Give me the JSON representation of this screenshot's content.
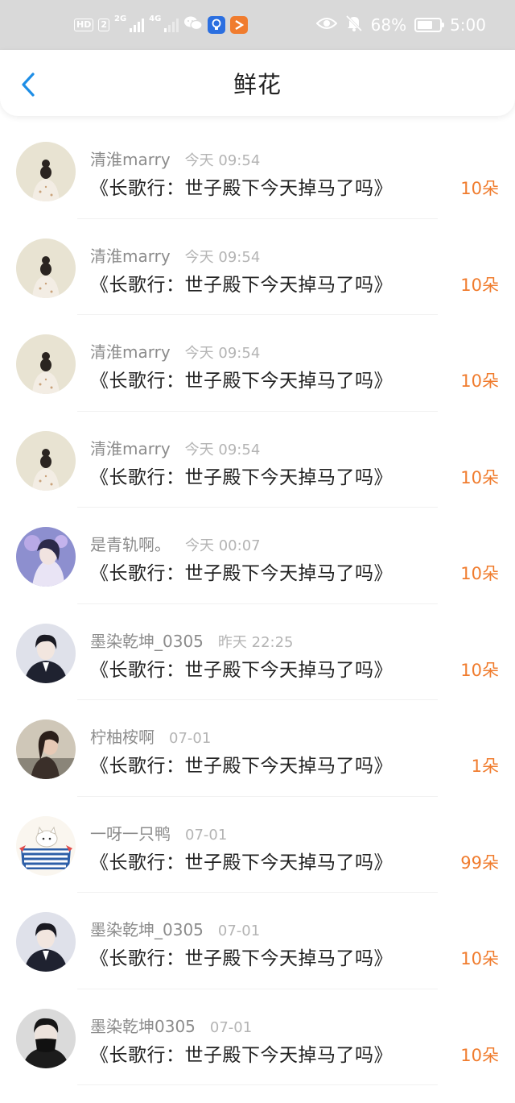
{
  "status_bar": {
    "hd_tag": "HD",
    "sim_tag": "2",
    "net1": "2G",
    "net2": "4G",
    "battery_percent": "68%",
    "battery_level": 0.68,
    "time": "5:00",
    "icons": [
      "eye-icon",
      "bell-mute-icon",
      "wechat-icon",
      "lightbulb-app-icon",
      "play-app-icon"
    ]
  },
  "nav": {
    "title": "鲜花",
    "back_icon": "chevron-left-icon",
    "accent_color": "#1e8ee6"
  },
  "colors": {
    "count": "#f07c2e",
    "username": "#8c8c8c",
    "time": "#b4b4b4"
  },
  "rows": [
    {
      "user": "清淮marry",
      "time": "今天 09:54",
      "title": "《长歌行：世子殿下今天掉马了吗》",
      "count": "10朵",
      "avatar": "avatar-girl-bun"
    },
    {
      "user": "清淮marry",
      "time": "今天 09:54",
      "title": "《长歌行：世子殿下今天掉马了吗》",
      "count": "10朵",
      "avatar": "avatar-girl-bun"
    },
    {
      "user": "清淮marry",
      "time": "今天 09:54",
      "title": "《长歌行：世子殿下今天掉马了吗》",
      "count": "10朵",
      "avatar": "avatar-girl-bun"
    },
    {
      "user": "清淮marry",
      "time": "今天 09:54",
      "title": "《长歌行：世子殿下今天掉马了吗》",
      "count": "10朵",
      "avatar": "avatar-girl-bun"
    },
    {
      "user": "是青轨啊。",
      "time": "今天 00:07",
      "title": "《长歌行：世子殿下今天掉马了吗》",
      "count": "10朵",
      "avatar": "avatar-girl-flowers"
    },
    {
      "user": "墨染乾坤_0305",
      "time": "昨天 22:25",
      "title": "《长歌行：世子殿下今天掉马了吗》",
      "count": "10朵",
      "avatar": "avatar-boy-suit"
    },
    {
      "user": "柠柚桉啊",
      "time": "07-01",
      "title": "《长歌行：世子殿下今天掉马了吗》",
      "count": "1朵",
      "avatar": "avatar-girl-profile"
    },
    {
      "user": "一呀一只鸭",
      "time": "07-01",
      "title": "《长歌行：世子殿下今天掉马了吗》",
      "count": "99朵",
      "avatar": "avatar-cartoon-cat"
    },
    {
      "user": "墨染乾坤_0305",
      "time": "07-01",
      "title": "《长歌行：世子殿下今天掉马了吗》",
      "count": "10朵",
      "avatar": "avatar-boy-suit"
    },
    {
      "user": "墨染乾坤0305",
      "time": "07-01",
      "title": "《长歌行：世子殿下今天掉马了吗》",
      "count": "10朵",
      "avatar": "avatar-boy-mask"
    }
  ]
}
